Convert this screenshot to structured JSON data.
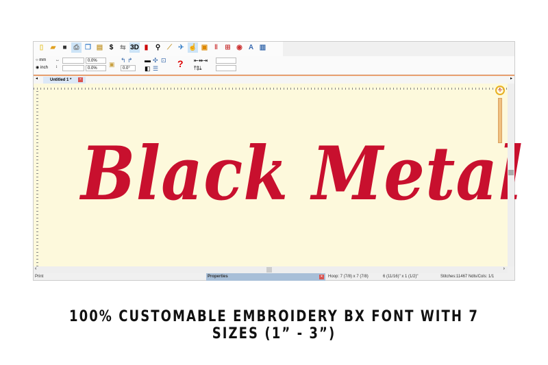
{
  "toolbar": {
    "icons": [
      "new-file",
      "open-folder",
      "save",
      "print",
      "copy",
      "paste",
      "stitch-convert",
      "mirror",
      "3d",
      "color-chart",
      "zoom",
      "measure",
      "hoop",
      "hand",
      "frame",
      "thread-colors",
      "pattern",
      "record",
      "text",
      "stitch-list"
    ],
    "three_d": "3D",
    "text_tool": "A"
  },
  "units": {
    "mm": "mm",
    "inch": "inch",
    "selected": "inch"
  },
  "size": {
    "width_value": "",
    "width_pct": "0.0%",
    "height_value": "",
    "height_pct": "0.0%",
    "rotate": "0.0°",
    "help": "?"
  },
  "tabs": [
    {
      "label": "Untitled 1 *"
    }
  ],
  "design": {
    "text": "Black Metal",
    "color": "#c8102e",
    "background": "#fdf9dc"
  },
  "status": {
    "left": "Print",
    "properties": "Properties",
    "hoop": "Hoop: 7 (7/8) x 7 (7/8)",
    "size": "6 (11/16)\" x 1 (1/2)\"",
    "stitches": "Stitches:11467  Ndls/Cols: 1/1"
  },
  "caption": "100% CUSTOMABLE EMBROIDERY BX FONT WITH 7 SIZES (1” -  3”)"
}
